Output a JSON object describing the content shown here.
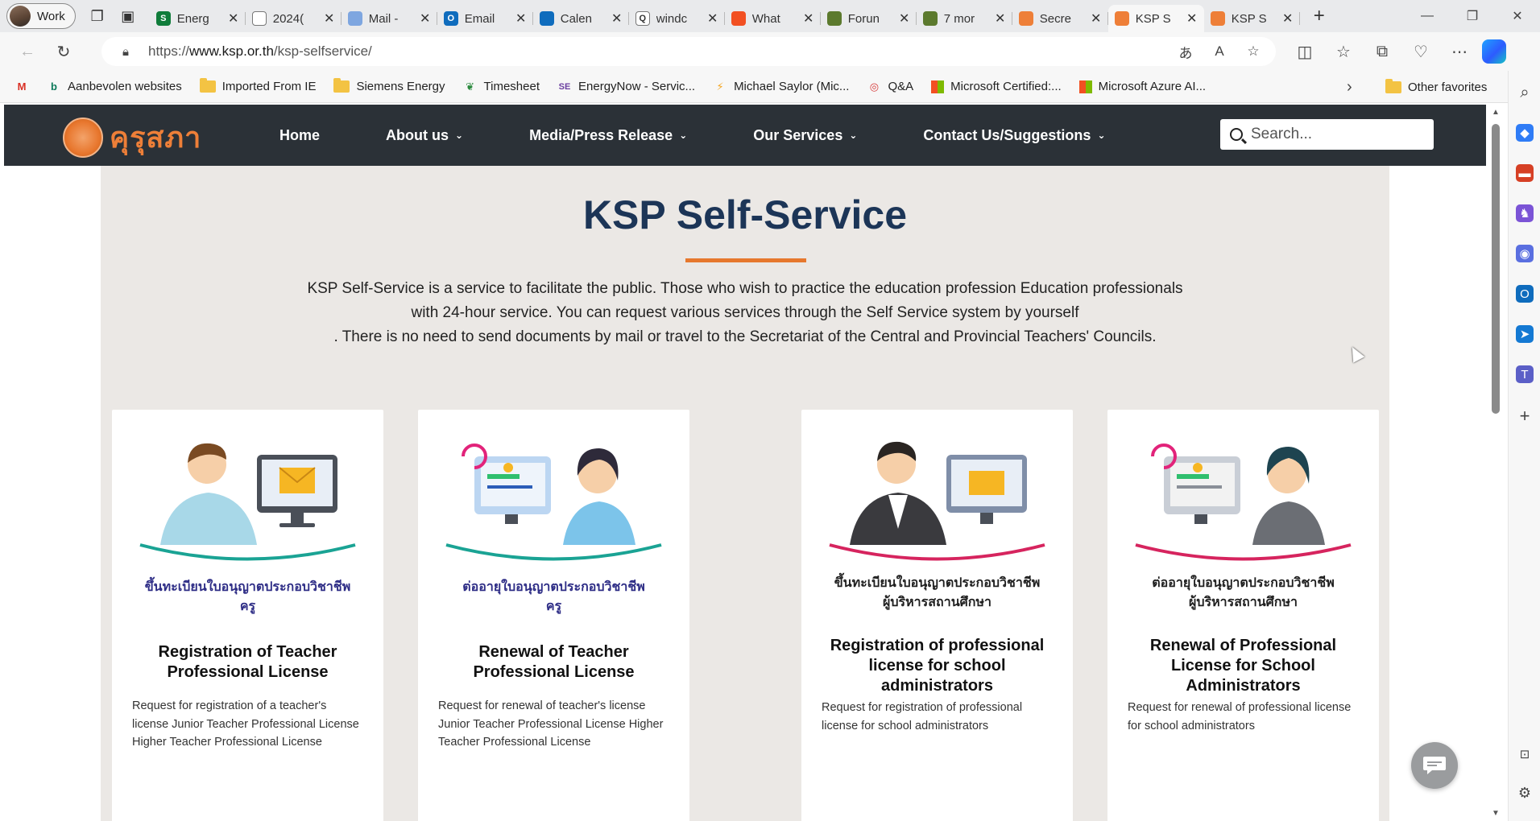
{
  "browser": {
    "profile_label": "Work",
    "tabs": [
      {
        "title": "Energ",
        "favicon_color": "#0f7c3a",
        "favicon_glyph": "S"
      },
      {
        "title": "2024(",
        "favicon_color": "#ffffff",
        "favicon_glyph": ""
      },
      {
        "title": "Mail -",
        "favicon_color": "#7ea6e0",
        "favicon_glyph": ""
      },
      {
        "title": "Email",
        "favicon_color": "#0f6cbd",
        "favicon_glyph": "O"
      },
      {
        "title": "Calen",
        "favicon_color": "#0f6cbd",
        "favicon_glyph": ""
      },
      {
        "title": "windc",
        "favicon_color": "#ffffff",
        "favicon_glyph": "Q"
      },
      {
        "title": "What",
        "favicon_color": "#f25022",
        "favicon_glyph": ""
      },
      {
        "title": "Forun",
        "favicon_color": "#5c7a2e",
        "favicon_glyph": ""
      },
      {
        "title": "7 mor",
        "favicon_color": "#5c7a2e",
        "favicon_glyph": ""
      },
      {
        "title": "Secre",
        "favicon_color": "#ee7f38",
        "favicon_glyph": ""
      },
      {
        "title": "KSP S",
        "favicon_color": "#ee7f38",
        "favicon_glyph": "",
        "active": true
      },
      {
        "title": "KSP S",
        "favicon_color": "#ee7f38",
        "favicon_glyph": ""
      }
    ],
    "url_prefix": "https://",
    "url_host": "www.ksp.or.th",
    "url_path": "/ksp-selfservice/",
    "favorites": [
      {
        "label": "Aanbevolen websites",
        "icon": "bing-icon"
      },
      {
        "label": "Imported From IE",
        "icon": "folder-icon"
      },
      {
        "label": "Siemens Energy",
        "icon": "folder-icon"
      },
      {
        "label": "Timesheet",
        "icon": "leaf-icon"
      },
      {
        "label": "EnergyNow - Servic...",
        "icon": "se-icon"
      },
      {
        "label": "Michael Saylor (Mic...",
        "icon": "bolt-icon"
      },
      {
        "label": "Q&A",
        "icon": "qa-icon"
      },
      {
        "label": "Microsoft Certified:...",
        "icon": "microsoft-icon"
      },
      {
        "label": "Microsoft Azure AI...",
        "icon": "microsoft-icon"
      }
    ],
    "other_favorites": "Other favorites"
  },
  "site": {
    "logo_text": "คุรุสภา",
    "nav": [
      {
        "label": "Home",
        "has_caret": false
      },
      {
        "label": "About us",
        "has_caret": true
      },
      {
        "label": "Media/Press Release",
        "has_caret": true
      },
      {
        "label": "Our Services",
        "has_caret": true
      },
      {
        "label": "Contact Us/Suggestions",
        "has_caret": true
      }
    ],
    "search_placeholder": "Search...",
    "accent_color": "#e6782e",
    "title_color": "#1c3557"
  },
  "main": {
    "title": "KSP Self-Service",
    "intro_lines": [
      "KSP Self-Service is a service to facilitate the public. Those who wish to practice the education profession Education professionals",
      "with 24-hour service. You can request various services through the Self Service system by yourself",
      ". There is no need to send documents by mail or travel to the Secretariat of the Central and Provincial Teachers' Councils."
    ],
    "cards": [
      {
        "thai_line1": "ขึ้นทะเบียนใบอนุญาตประกอบวิชาชีพ",
        "thai_line2": "ครู",
        "title": "Registration of Teacher Professional License",
        "description": "Request for registration of a teacher's license Junior Teacher Professional License Higher Teacher Professional License"
      },
      {
        "thai_line1": "ต่ออายุใบอนุญาตประกอบวิชาชีพ",
        "thai_line2": "ครู",
        "title": "Renewal of Teacher Professional License",
        "description": "Request for renewal of teacher's license Junior Teacher Professional License Higher Teacher Professional License"
      },
      {
        "thai_line1": "ขึ้นทะเบียนใบอนุญาตประกอบวิชาชีพ",
        "thai_line2": "ผู้บริหารสถานศึกษา",
        "title": "Registration of professional license for school administrators",
        "description": "Request for registration of professional license for school administrators"
      },
      {
        "thai_line1": "ต่ออายุใบอนุญาตประกอบวิชาชีพ",
        "thai_line2": "ผู้บริหารสถานศึกษา",
        "title": "Renewal of Professional License for School Administrators",
        "description": "Request for renewal of professional license for school administrators"
      }
    ]
  }
}
